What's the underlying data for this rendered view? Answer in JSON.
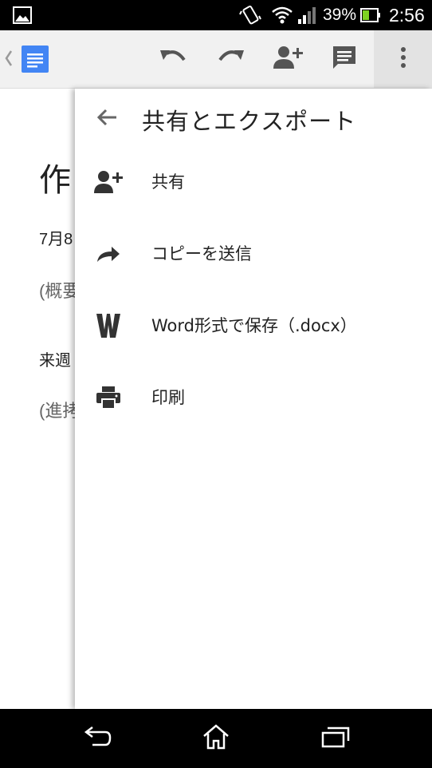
{
  "status_bar": {
    "battery_percent": "39%",
    "time": "2:56",
    "icons": [
      "image-icon",
      "vibrate-icon",
      "wifi-icon",
      "signal-icon",
      "battery-icon"
    ]
  },
  "toolbar": {
    "icons": [
      "back-chevron-icon",
      "docs-app-icon",
      "undo-icon",
      "redo-icon",
      "add-person-icon",
      "comment-icon",
      "more-vert-icon"
    ],
    "accent": "#4285f4"
  },
  "document": {
    "lines": [
      "作",
      "7月8",
      "(概要",
      "来週",
      "(進拷"
    ]
  },
  "panel": {
    "title": "共有とエクスポート",
    "items": [
      {
        "label": "共有",
        "icon": "add-person-icon"
      },
      {
        "label": "コピーを送信",
        "icon": "forward-arrow-icon"
      },
      {
        "label": "Word形式で保存（.docx）",
        "icon": "word-icon"
      },
      {
        "label": "印刷",
        "icon": "print-icon"
      }
    ]
  },
  "nav_bar": {
    "icons": [
      "back-icon",
      "home-icon",
      "recent-apps-icon"
    ]
  }
}
